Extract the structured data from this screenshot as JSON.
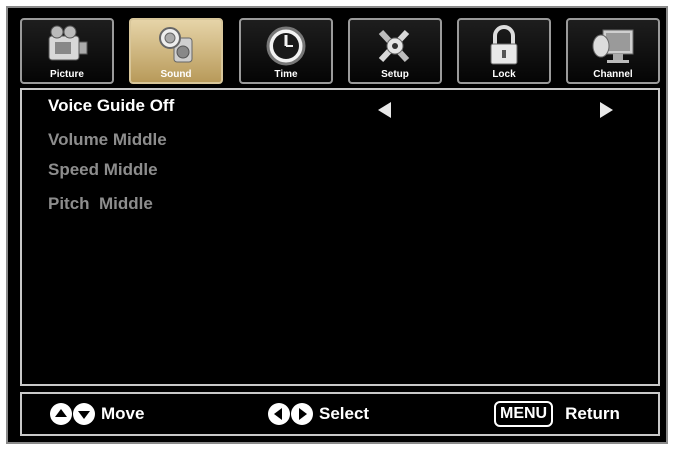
{
  "tabs": [
    {
      "label": "Picture",
      "icon": "camcorder-icon",
      "active": false
    },
    {
      "label": "Sound",
      "icon": "speaker-icon",
      "active": true
    },
    {
      "label": "Time",
      "icon": "clock-icon",
      "active": false
    },
    {
      "label": "Setup",
      "icon": "tools-icon",
      "active": false
    },
    {
      "label": "Lock",
      "icon": "padlock-icon",
      "active": false
    },
    {
      "label": "Channel",
      "icon": "tv-satellite-icon",
      "active": false
    }
  ],
  "menu": {
    "items": [
      {
        "label": "Voice Guide Off",
        "selected": true
      },
      {
        "label": "Volume Middle",
        "selected": false
      },
      {
        "label": "Speed Middle",
        "selected": false
      },
      {
        "label": "Pitch  Middle",
        "selected": false
      }
    ]
  },
  "footer": {
    "move_label": "Move",
    "select_label": "Select",
    "menu_key": "MENU",
    "return_label": "Return"
  },
  "colors": {
    "background": "#000000",
    "active_tab": "#d2b97e",
    "selected_text": "#ffffff",
    "dim_text": "#8d8d8d"
  }
}
